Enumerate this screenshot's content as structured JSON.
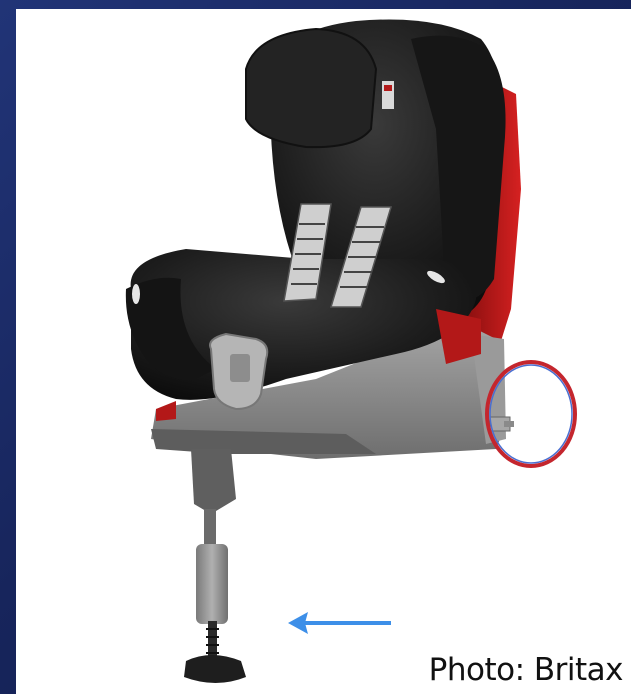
{
  "caption": {
    "text": "Photo: Britax"
  },
  "annotations": {
    "circle_color": "#c4262e",
    "circle_inner_color": "#4a6fd1",
    "arrow_color": "#3d8fe8"
  },
  "subject": {
    "fabric_color": "#1b1b1b",
    "base_color": "#8e8e8e",
    "accent_color": "#b31818"
  }
}
